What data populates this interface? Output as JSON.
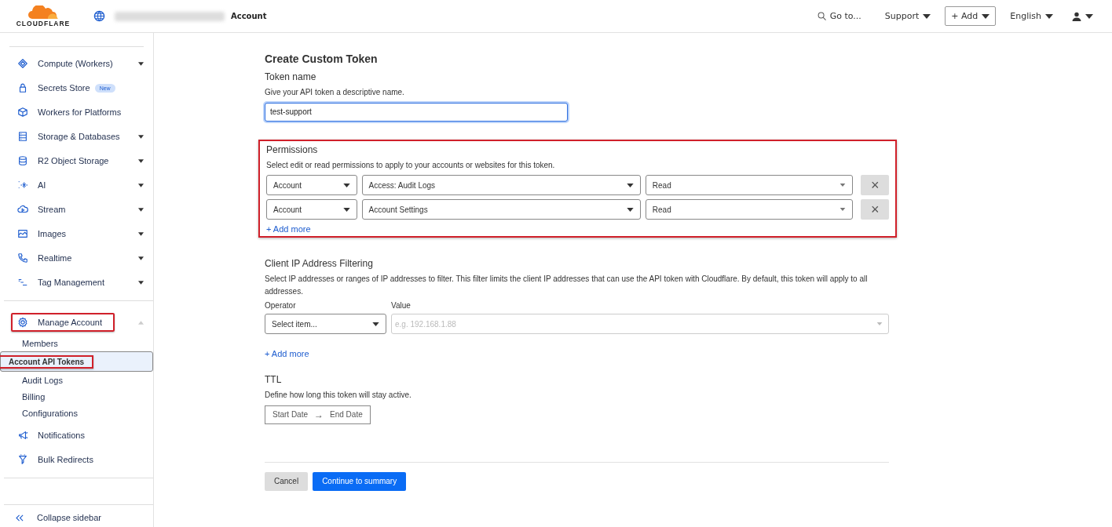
{
  "header": {
    "logo": "CLOUDFLARE",
    "crumb": "Account",
    "search": "Go to...",
    "menus": [
      {
        "label": "Support",
        "kind": "menu"
      },
      {
        "label": "+ Add",
        "kind": "button"
      },
      {
        "label": "English",
        "kind": "menu"
      }
    ]
  },
  "sidebar": {
    "items": [
      {
        "label": "Compute (Workers)",
        "kind": "group",
        "expanded": false,
        "highlighted": false
      },
      {
        "label": "Secrets Store",
        "kind": "link",
        "badge": "New",
        "highlighted": false
      },
      {
        "label": "Workers for Platforms",
        "kind": "link",
        "highlighted": false
      },
      {
        "label": "Storage & Databases",
        "kind": "group",
        "expanded": false,
        "highlighted": false
      },
      {
        "label": "R2 Object Storage",
        "kind": "group",
        "expanded": false,
        "highlighted": false
      },
      {
        "label": "AI",
        "kind": "group",
        "expanded": false,
        "highlighted": false
      },
      {
        "label": "Stream",
        "kind": "group",
        "expanded": false,
        "highlighted": false
      },
      {
        "label": "Images",
        "kind": "group",
        "expanded": false,
        "highlighted": false
      },
      {
        "label": "Realtime",
        "kind": "group",
        "expanded": false,
        "highlighted": false
      },
      {
        "label": "Tag Management",
        "kind": "group",
        "expanded": false,
        "highlighted": false
      },
      {
        "label": "Manage Account",
        "kind": "group",
        "expanded": true,
        "highlighted": true,
        "children": [
          {
            "label": "Members",
            "selected": false,
            "highlighted": false
          },
          {
            "label": "Account API Tokens",
            "selected": true,
            "highlighted": true
          },
          {
            "label": "Audit Logs",
            "selected": false,
            "highlighted": false
          },
          {
            "label": "Billing",
            "selected": false,
            "highlighted": false
          },
          {
            "label": "Configurations",
            "selected": false,
            "highlighted": false
          }
        ]
      },
      {
        "label": "Notifications",
        "kind": "link",
        "highlighted": false
      },
      {
        "label": "Bulk Redirects",
        "kind": "link",
        "highlighted": false
      }
    ],
    "collapse": "Collapse sidebar"
  },
  "form": {
    "title": "Create Custom Token",
    "token_name": {
      "label": "Token name",
      "hint": "Give your API token a descriptive name.",
      "value": "test-support"
    },
    "permissions": {
      "label": "Permissions",
      "highlighted": true,
      "hint": "Select edit or read permissions to apply to your accounts or websites for this token.",
      "rows": [
        {
          "scope": "Account",
          "permission": "Access: Audit Logs",
          "access": "Read",
          "remove": "×"
        },
        {
          "scope": "Account",
          "permission": "Account Settings",
          "access": "Read",
          "remove": "×"
        }
      ],
      "add_more": "+ Add more"
    },
    "ip_filtering": {
      "label": "Client IP Address Filtering",
      "hint": "Select IP addresses or ranges of IP addresses to filter. This filter limits the client IP addresses that can use the API token with Cloudflare. By default, this token will apply to all addresses.",
      "operator_label": "Operator",
      "operator": "Select item...",
      "value_label": "Value",
      "value_placeholder": "e.g. 192.168.1.88",
      "add_more": "+ Add more"
    },
    "ttl": {
      "label": "TTL",
      "hint": "Define how long this token will stay active.",
      "start": "Start Date",
      "arrow": "→",
      "end": "End Date"
    },
    "buttons": [
      {
        "label": "Cancel",
        "kind": "secondary"
      },
      {
        "label": "Continue to summary",
        "kind": "primary"
      }
    ]
  }
}
